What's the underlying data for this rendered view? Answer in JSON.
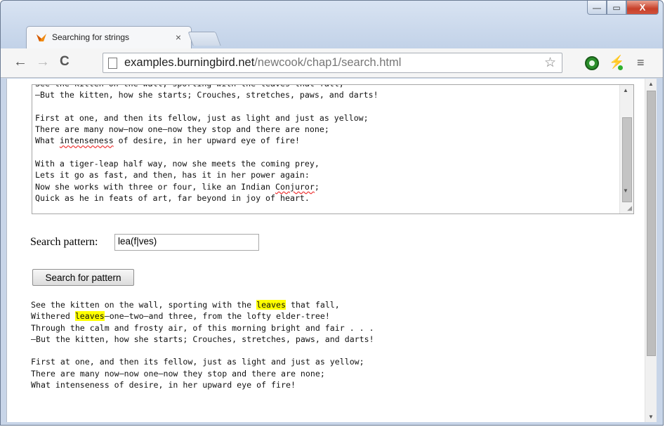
{
  "window": {
    "minimize_label": "—",
    "maximize_label": "▭",
    "close_label": "X"
  },
  "tab": {
    "title": "Searching for strings",
    "close_label": "×"
  },
  "toolbar": {
    "back_label": "←",
    "forward_label": "→",
    "reload_label": "C",
    "url_host": "examples.burningbird.net",
    "url_path": "/newcook/chap1/search.html",
    "star_label": "☆",
    "menu_label": "≡"
  },
  "textarea": {
    "lines": [
      "—But the kitten, how she starts; Crouches, stretches, paws, and darts!",
      "",
      "First at one, and then its fellow, just as light and just as yellow;",
      "There are many now—now one—now they stop and there are none;",
      "What intenseness of desire, in her upward eye of fire!",
      "",
      "With a tiger-leap half way, now she meets the coming prey,",
      "Lets it go as fast, and then, has it in her power again:",
      "Now she works with three or four, like an Indian Conjuror;",
      "Quick as he in feats of art, far beyond in joy of heart."
    ]
  },
  "search": {
    "label": "Search pattern:",
    "value": "lea(f|ves)",
    "button_label": "Search for pattern"
  },
  "results": {
    "line1_before": "See the kitten on the wall, sporting with the ",
    "line1_match": "leaves",
    "line1_after": " that fall,",
    "line2_before": "Withered ",
    "line2_match": "leaves",
    "line2_after": "—one—two—and three, from the lofty elder-tree!",
    "other_lines": [
      "Through the calm and frosty air, of this morning bright and fair . . .",
      "—But the kitten, how she starts; Crouches, stretches, paws, and darts!",
      "",
      "First at one, and then its fellow, just as light and just as yellow;",
      "There are many now—now one—now they stop and there are none;",
      "What intenseness of desire, in her upward eye of fire!"
    ],
    "highlight_color": "#ffff00"
  }
}
